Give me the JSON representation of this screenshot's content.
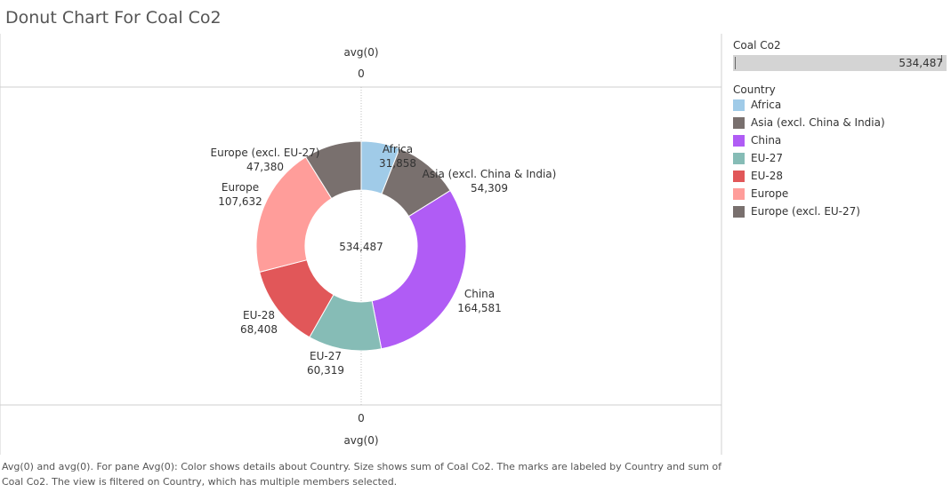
{
  "title": "Donut Chart For Coal Co2",
  "panes": {
    "top_header": "avg(0)",
    "top_tick": "0",
    "bottom_tick": "0",
    "bottom_header": "avg(0)"
  },
  "legend": {
    "size_title": "Coal Co2",
    "size_value": "534,487",
    "color_title": "Country",
    "items": [
      {
        "label": "Africa",
        "color": "#a0cbe8"
      },
      {
        "label": "Asia (excl. China & India)",
        "color": "#79706e"
      },
      {
        "label": "China",
        "color": "#b05cf5"
      },
      {
        "label": "EU-27",
        "color": "#86bcb6"
      },
      {
        "label": "EU-28",
        "color": "#e15759"
      },
      {
        "label": "Europe",
        "color": "#ff9d9a"
      },
      {
        "label": "Europe (excl. EU-27)",
        "color": "#79706e"
      }
    ]
  },
  "chart_data": {
    "type": "pie",
    "title": "Donut Chart For Coal Co2",
    "center_label": "534,487",
    "total": 534487,
    "slices": [
      {
        "label": "Africa",
        "value": 31858,
        "value_label": "31,858",
        "color": "#a0cbe8"
      },
      {
        "label": "Asia (excl. China & India)",
        "value": 54309,
        "value_label": "54,309",
        "color": "#79706e"
      },
      {
        "label": "China",
        "value": 164581,
        "value_label": "164,581",
        "color": "#b05cf5"
      },
      {
        "label": "EU-27",
        "value": 60319,
        "value_label": "60,319",
        "color": "#86bcb6"
      },
      {
        "label": "EU-28",
        "value": 68408,
        "value_label": "68,408",
        "color": "#e15759"
      },
      {
        "label": "Europe",
        "value": 107632,
        "value_label": "107,632",
        "color": "#ff9d9a"
      },
      {
        "label": "Europe (excl. EU-27)",
        "value": 47380,
        "value_label": "47,380",
        "color": "#79706e"
      }
    ]
  },
  "caption": "Avg(0) and avg(0).  For pane Avg(0): Color shows details about Country.  Size shows sum of Coal Co2.  The marks are labeled by Country and sum of Coal Co2. The view is filtered on Country, which has multiple members selected."
}
